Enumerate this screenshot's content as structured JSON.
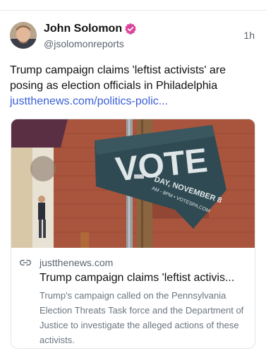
{
  "author": {
    "name": "John Solomon",
    "handle": "@jsolomonreports",
    "verified_icon": "verified-badge-icon",
    "verified_color": "#d9469b"
  },
  "post": {
    "time": "1h",
    "text": "Trump campaign claims 'leftist activists' are posing as election officials in Philadelphia",
    "link": "justthenews.com/politics-polic..."
  },
  "card": {
    "image_sign_text": "VOTE",
    "image_sign_sub": "DAY, NOVEMBER 8",
    "image_sign_sub2": "AM - 8PM • VOTESPA.COM",
    "domain": "justthenews.com",
    "title": "Trump campaign claims 'leftist activis...",
    "description": "Trump's campaign called on the Pennsylvania Election Threats Task force and the Department of Justice to investigate the alleged actions of these activists."
  },
  "colors": {
    "link": "#3a5fd6",
    "muted": "#5b6570"
  }
}
